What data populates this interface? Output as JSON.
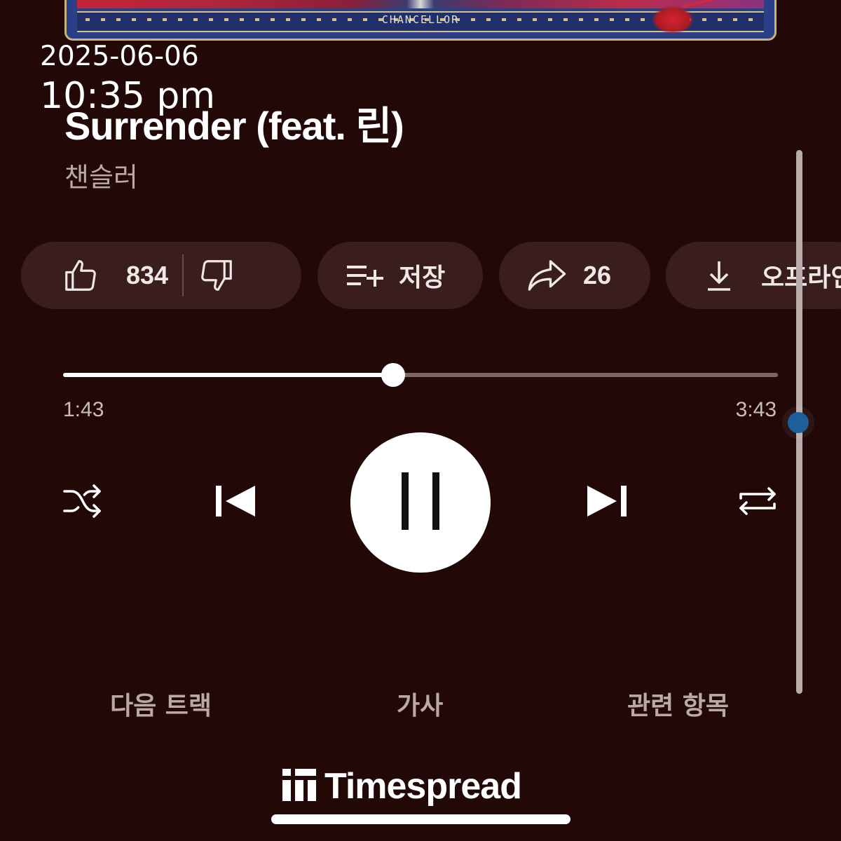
{
  "album_art": {
    "label": "CHANCELLOR"
  },
  "overlay": {
    "date": "2025-06-06",
    "time": "10:35 pm"
  },
  "track": {
    "title": "Surrender (feat. 린)",
    "artist": "챈슬러"
  },
  "actions": {
    "like_count": "834",
    "save_label": "저장",
    "share_count": "26",
    "offline_label": "오프라인"
  },
  "playback": {
    "elapsed": "1:43",
    "duration": "3:43",
    "progress_fraction": 0.462,
    "state": "playing"
  },
  "icons": {
    "like": "thumbs-up-icon",
    "dislike": "thumbs-down-icon",
    "save": "playlist-add-icon",
    "share": "share-arrow-icon",
    "download": "download-icon",
    "shuffle": "shuffle-icon",
    "previous": "skip-previous-icon",
    "pause": "pause-icon",
    "next": "skip-next-icon",
    "repeat": "repeat-icon"
  },
  "tabs": [
    "다음 트랙",
    "가사",
    "관련 항목"
  ],
  "watermark": {
    "text": "Timespread"
  },
  "colors": {
    "background": "#230808",
    "chip": "#3a1d1d",
    "accent_dot": "#1c5f9a"
  }
}
